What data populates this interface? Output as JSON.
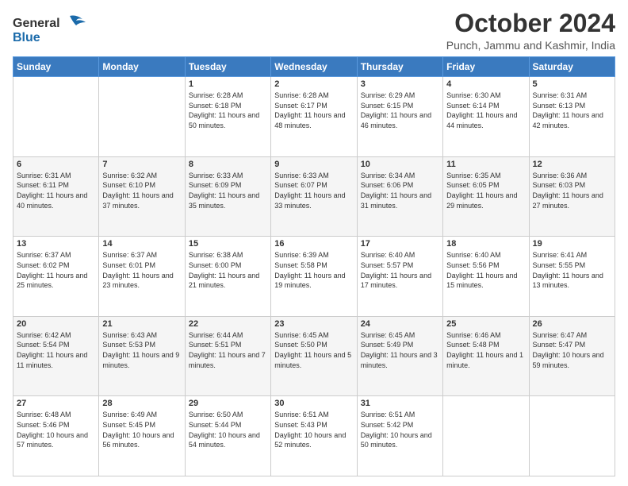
{
  "logo": {
    "line1": "General",
    "line2": "Blue"
  },
  "header": {
    "title": "October 2024",
    "subtitle": "Punch, Jammu and Kashmir, India"
  },
  "days_of_week": [
    "Sunday",
    "Monday",
    "Tuesday",
    "Wednesday",
    "Thursday",
    "Friday",
    "Saturday"
  ],
  "weeks": [
    [
      {
        "day": "",
        "content": ""
      },
      {
        "day": "",
        "content": ""
      },
      {
        "day": "1",
        "content": "Sunrise: 6:28 AM\nSunset: 6:18 PM\nDaylight: 11 hours and 50 minutes."
      },
      {
        "day": "2",
        "content": "Sunrise: 6:28 AM\nSunset: 6:17 PM\nDaylight: 11 hours and 48 minutes."
      },
      {
        "day": "3",
        "content": "Sunrise: 6:29 AM\nSunset: 6:15 PM\nDaylight: 11 hours and 46 minutes."
      },
      {
        "day": "4",
        "content": "Sunrise: 6:30 AM\nSunset: 6:14 PM\nDaylight: 11 hours and 44 minutes."
      },
      {
        "day": "5",
        "content": "Sunrise: 6:31 AM\nSunset: 6:13 PM\nDaylight: 11 hours and 42 minutes."
      }
    ],
    [
      {
        "day": "6",
        "content": "Sunrise: 6:31 AM\nSunset: 6:11 PM\nDaylight: 11 hours and 40 minutes."
      },
      {
        "day": "7",
        "content": "Sunrise: 6:32 AM\nSunset: 6:10 PM\nDaylight: 11 hours and 37 minutes."
      },
      {
        "day": "8",
        "content": "Sunrise: 6:33 AM\nSunset: 6:09 PM\nDaylight: 11 hours and 35 minutes."
      },
      {
        "day": "9",
        "content": "Sunrise: 6:33 AM\nSunset: 6:07 PM\nDaylight: 11 hours and 33 minutes."
      },
      {
        "day": "10",
        "content": "Sunrise: 6:34 AM\nSunset: 6:06 PM\nDaylight: 11 hours and 31 minutes."
      },
      {
        "day": "11",
        "content": "Sunrise: 6:35 AM\nSunset: 6:05 PM\nDaylight: 11 hours and 29 minutes."
      },
      {
        "day": "12",
        "content": "Sunrise: 6:36 AM\nSunset: 6:03 PM\nDaylight: 11 hours and 27 minutes."
      }
    ],
    [
      {
        "day": "13",
        "content": "Sunrise: 6:37 AM\nSunset: 6:02 PM\nDaylight: 11 hours and 25 minutes."
      },
      {
        "day": "14",
        "content": "Sunrise: 6:37 AM\nSunset: 6:01 PM\nDaylight: 11 hours and 23 minutes."
      },
      {
        "day": "15",
        "content": "Sunrise: 6:38 AM\nSunset: 6:00 PM\nDaylight: 11 hours and 21 minutes."
      },
      {
        "day": "16",
        "content": "Sunrise: 6:39 AM\nSunset: 5:58 PM\nDaylight: 11 hours and 19 minutes."
      },
      {
        "day": "17",
        "content": "Sunrise: 6:40 AM\nSunset: 5:57 PM\nDaylight: 11 hours and 17 minutes."
      },
      {
        "day": "18",
        "content": "Sunrise: 6:40 AM\nSunset: 5:56 PM\nDaylight: 11 hours and 15 minutes."
      },
      {
        "day": "19",
        "content": "Sunrise: 6:41 AM\nSunset: 5:55 PM\nDaylight: 11 hours and 13 minutes."
      }
    ],
    [
      {
        "day": "20",
        "content": "Sunrise: 6:42 AM\nSunset: 5:54 PM\nDaylight: 11 hours and 11 minutes."
      },
      {
        "day": "21",
        "content": "Sunrise: 6:43 AM\nSunset: 5:53 PM\nDaylight: 11 hours and 9 minutes."
      },
      {
        "day": "22",
        "content": "Sunrise: 6:44 AM\nSunset: 5:51 PM\nDaylight: 11 hours and 7 minutes."
      },
      {
        "day": "23",
        "content": "Sunrise: 6:45 AM\nSunset: 5:50 PM\nDaylight: 11 hours and 5 minutes."
      },
      {
        "day": "24",
        "content": "Sunrise: 6:45 AM\nSunset: 5:49 PM\nDaylight: 11 hours and 3 minutes."
      },
      {
        "day": "25",
        "content": "Sunrise: 6:46 AM\nSunset: 5:48 PM\nDaylight: 11 hours and 1 minute."
      },
      {
        "day": "26",
        "content": "Sunrise: 6:47 AM\nSunset: 5:47 PM\nDaylight: 10 hours and 59 minutes."
      }
    ],
    [
      {
        "day": "27",
        "content": "Sunrise: 6:48 AM\nSunset: 5:46 PM\nDaylight: 10 hours and 57 minutes."
      },
      {
        "day": "28",
        "content": "Sunrise: 6:49 AM\nSunset: 5:45 PM\nDaylight: 10 hours and 56 minutes."
      },
      {
        "day": "29",
        "content": "Sunrise: 6:50 AM\nSunset: 5:44 PM\nDaylight: 10 hours and 54 minutes."
      },
      {
        "day": "30",
        "content": "Sunrise: 6:51 AM\nSunset: 5:43 PM\nDaylight: 10 hours and 52 minutes."
      },
      {
        "day": "31",
        "content": "Sunrise: 6:51 AM\nSunset: 5:42 PM\nDaylight: 10 hours and 50 minutes."
      },
      {
        "day": "",
        "content": ""
      },
      {
        "day": "",
        "content": ""
      }
    ]
  ]
}
